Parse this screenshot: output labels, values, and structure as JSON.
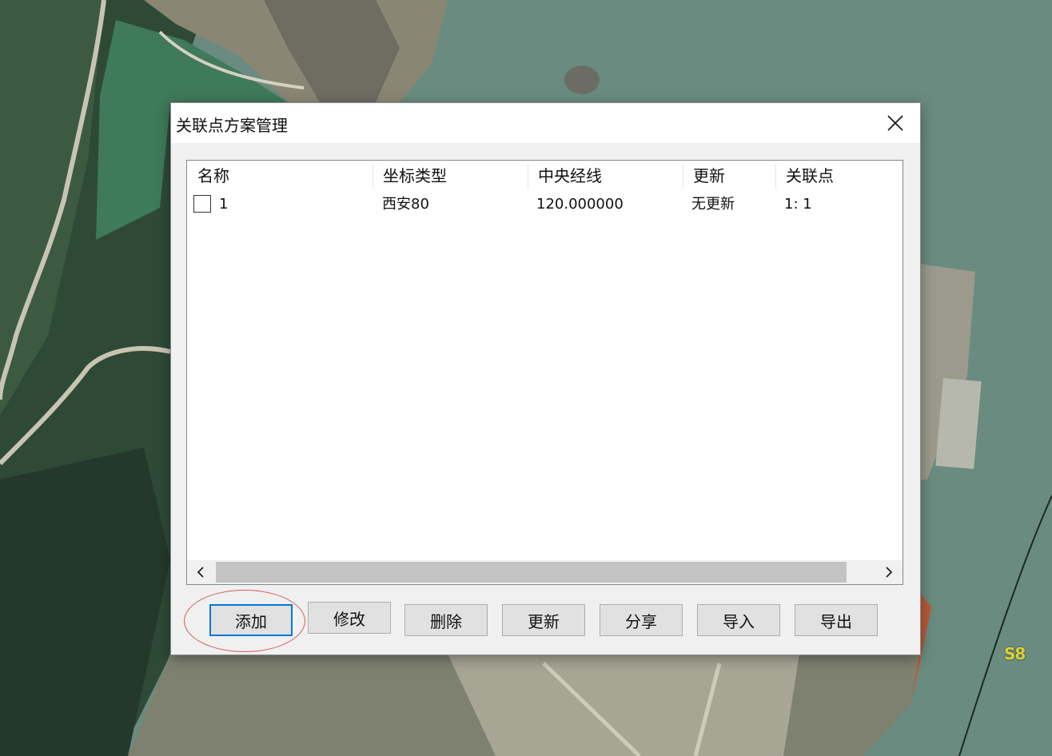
{
  "dialog": {
    "title": "关联点方案管理",
    "close_icon": "close-icon"
  },
  "table": {
    "columns": [
      "名称",
      "坐标类型",
      "中央经线",
      "更新",
      "关联点"
    ],
    "rows": [
      {
        "checked": false,
        "name": "1",
        "coord_type": "西安80",
        "central_meridian": "120.000000",
        "update": "无更新",
        "link_points": "1: 1"
      }
    ],
    "scroll_left_icon": "chevron-left-icon",
    "scroll_right_icon": "chevron-right-icon"
  },
  "buttons": {
    "add": "添加",
    "modify": "修改",
    "delete": "删除",
    "update": "更新",
    "share": "分享",
    "import": "导入",
    "export": "导出"
  },
  "map": {
    "label": "S8"
  },
  "colors": {
    "highlight_ring": "#d85a5a",
    "default_button_border": "#0078d7",
    "map_label": "#d9d233"
  }
}
